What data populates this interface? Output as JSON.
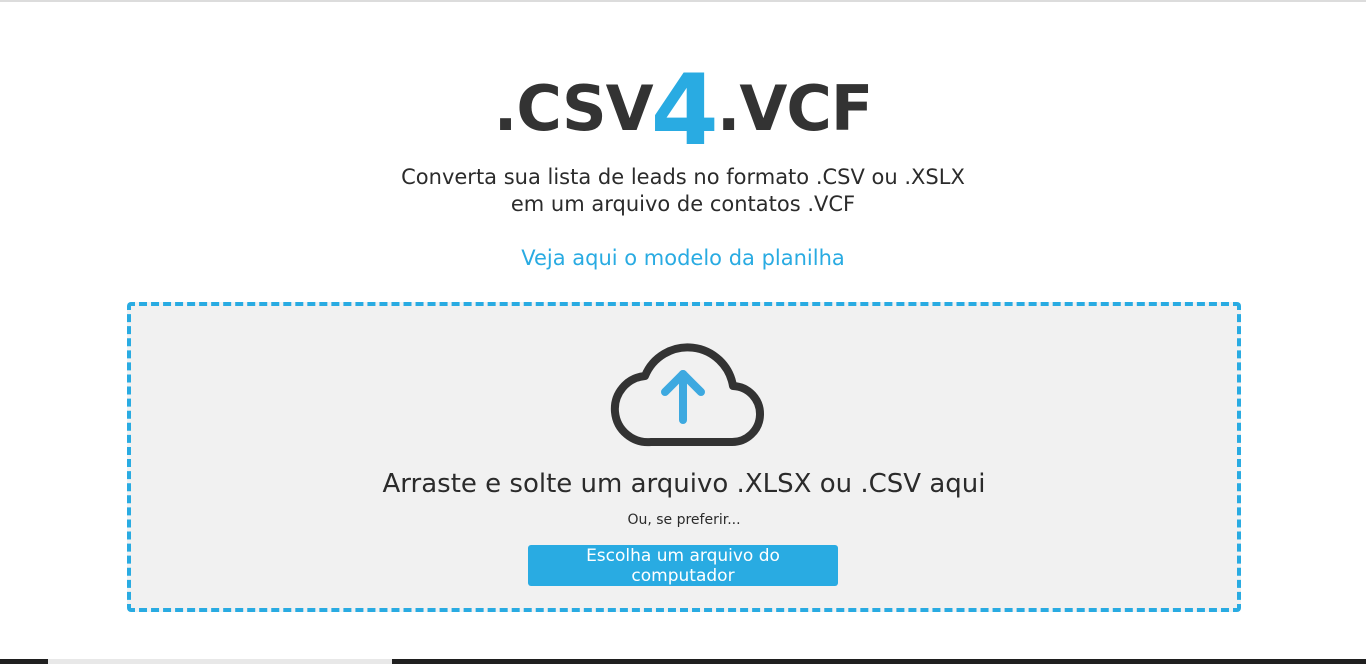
{
  "logo": {
    "prefix": ".CSV",
    "number": "4",
    "suffix": ".VCF"
  },
  "subtitle": "Converta sua lista de leads no formato .CSV ou .XSLX em um arquivo de contatos .VCF",
  "template_link": "Veja aqui o modelo da planilha",
  "dropzone": {
    "icon": "cloud-upload-icon",
    "title": "Arraste e solte um arquivo .XLSX ou .CSV aqui",
    "or_text": "Ou, se preferir...",
    "button_label": "Escolha um arquivo do computador"
  },
  "colors": {
    "accent": "#29abe2",
    "text": "#2b2b2b",
    "dropzone_bg": "#f1f1f1"
  }
}
